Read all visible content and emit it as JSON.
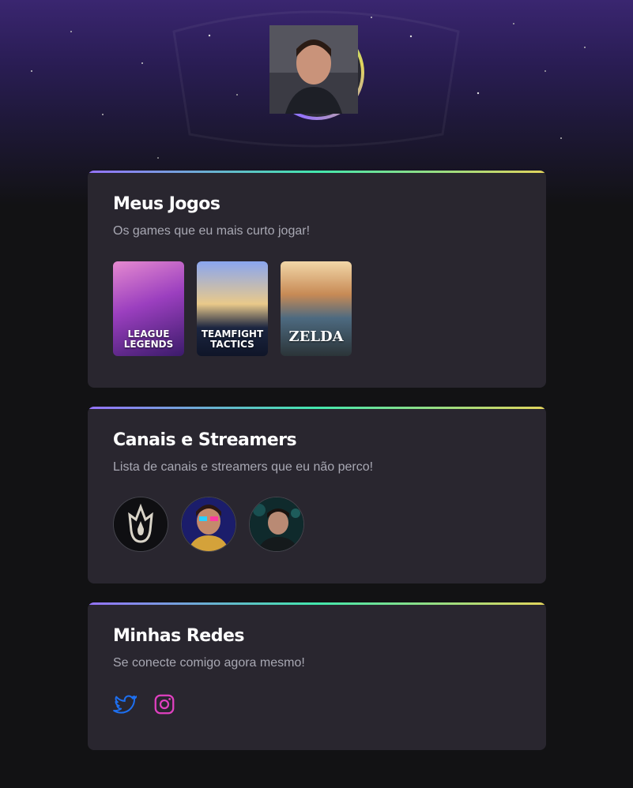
{
  "profile": {
    "avatar_alt": "Foto de perfil"
  },
  "cards": {
    "games": {
      "title": "Meus Jogos",
      "subtitle": "Os games que eu mais curto jogar!",
      "items": [
        {
          "name": "LEAGUE OF LEGENDS",
          "line1": "LEAGUE",
          "line2": "LEGENDS",
          "accent": "#c4349a"
        },
        {
          "name": "TEAMFIGHT TACTICS",
          "line1": "TEAMFIGHT",
          "line2": "TACTICS",
          "accent": "#6f8fe3"
        },
        {
          "name": "ZELDA",
          "line1": "ZELDA",
          "line2": "",
          "accent": "#e8a86a"
        }
      ]
    },
    "streamers": {
      "title": "Canais e Streamers",
      "subtitle": "Lista de canais e streamers que eu não perco!",
      "items": [
        {
          "name": "streamer-1"
        },
        {
          "name": "streamer-2"
        },
        {
          "name": "streamer-3"
        }
      ]
    },
    "socials": {
      "title": "Minhas Redes",
      "subtitle": "Se conecte comigo agora mesmo!",
      "items": [
        {
          "icon": "twitter-icon",
          "color": "#1d9bf0"
        },
        {
          "icon": "instagram-icon",
          "color": "#e040c0"
        }
      ]
    }
  },
  "colors": {
    "background": "#121214",
    "card": "#29262f",
    "gradient": [
      "#9572fc",
      "#43e7ad",
      "#e2d45c"
    ]
  }
}
